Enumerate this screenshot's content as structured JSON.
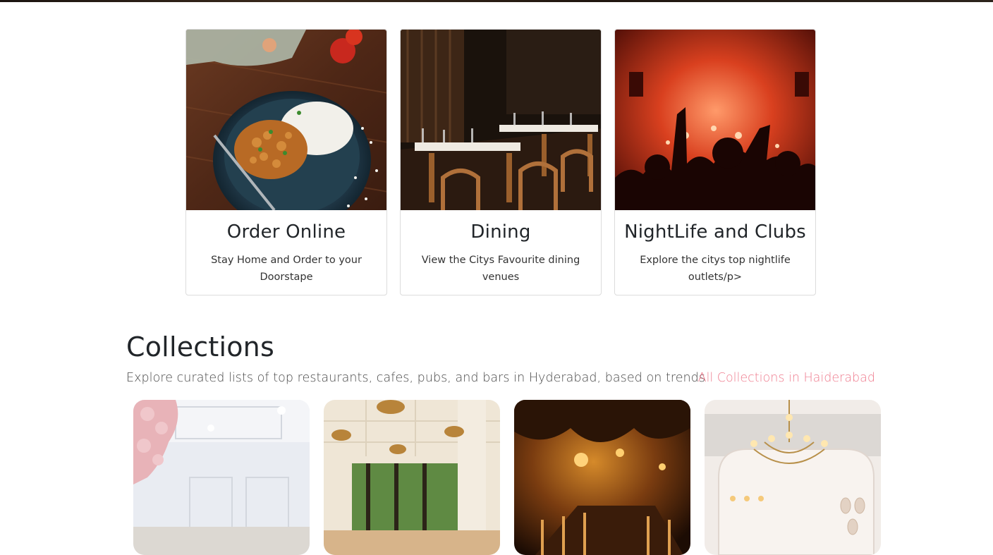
{
  "cards": [
    {
      "title": "Order Online",
      "text": "Stay Home and Order to your Doorstape",
      "image_icon": "food-plate-photo"
    },
    {
      "title": "Dining",
      "text": "View the Citys Favourite dining venues",
      "image_icon": "restaurant-interior-photo"
    },
    {
      "title": "NightLife and Clubs",
      "text": "Explore the citys top nightlife outlets/p>",
      "image_icon": "nightclub-crowd-photo"
    }
  ],
  "collections": {
    "title": "Collections",
    "subtitle": "Explore curated lists of top restaurants, cafes, pubs, and bars in Hyderabad, based on trends",
    "link_label": "All Collections in Haiderabad",
    "link_color": "#ef7d8f",
    "items": [
      {
        "image_icon": "white-cafe-interior-photo"
      },
      {
        "image_icon": "sunlit-restaurant-photo"
      },
      {
        "image_icon": "cave-themed-restaurant-photo"
      },
      {
        "image_icon": "chandelier-dining-room-photo"
      }
    ]
  }
}
